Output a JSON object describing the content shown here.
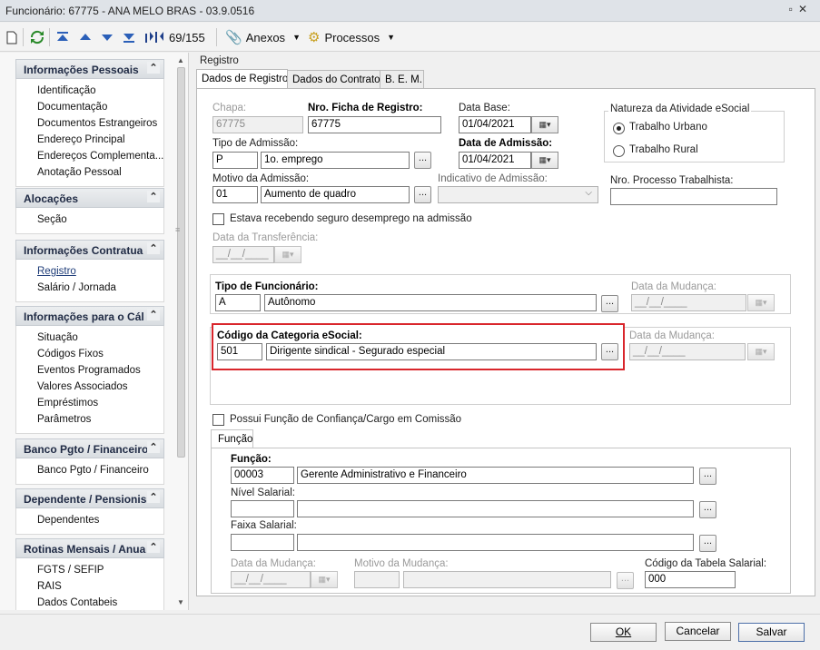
{
  "window": {
    "title": "Funcionário: 67775 - ANA MELO BRAS - 03.9.0516"
  },
  "toolbar": {
    "record_counter": "69/155",
    "anexos_label": "Anexos",
    "processos_label": "Processos"
  },
  "sidebar": {
    "groups": [
      {
        "title": "Informações Pessoais",
        "items": [
          "Identificação",
          "Documentação",
          "Documentos Estrangeiros",
          "Endereço Principal",
          "Endereços Complementa...",
          "Anotação Pessoal"
        ]
      },
      {
        "title": "Alocações",
        "items": [
          "Seção"
        ]
      },
      {
        "title": "Informações Contratua",
        "items": [
          "Registro",
          "Salário / Jornada"
        ],
        "selected": "Registro"
      },
      {
        "title": "Informações para o Cál",
        "items": [
          "Situação",
          "Códigos Fixos",
          "Eventos Programados",
          "Valores Associados",
          "Empréstimos",
          "Parâmetros"
        ]
      },
      {
        "title": "Banco Pgto / Financeiro",
        "items": [
          "Banco Pgto / Financeiro"
        ]
      },
      {
        "title": "Dependente / Pensionis",
        "items": [
          "Dependentes"
        ]
      },
      {
        "title": "Rotinas Mensais / Anua",
        "items": [
          "FGTS / SEFIP",
          "RAIS",
          "Dados Contabeis"
        ]
      }
    ]
  },
  "main": {
    "section_title": "Registro",
    "tabs": [
      "Dados de Registro",
      "Dados do Contrato",
      "B. E. M."
    ],
    "form": {
      "chapa_label": "Chapa:",
      "chapa_value": "67775",
      "nro_ficha_label": "Nro. Ficha de Registro:",
      "nro_ficha_value": "67775",
      "data_base_label": "Data Base:",
      "data_base_value": "01/04/2021",
      "tipo_admissao_label": "Tipo de Admissão:",
      "tipo_admissao_code": "P",
      "tipo_admissao_desc": "1o. emprego",
      "data_admissao_label": "Data de Admissão:",
      "data_admissao_value": "01/04/2021",
      "motivo_label": "Motivo da Admissão:",
      "motivo_code": "01",
      "motivo_desc": "Aumento de quadro",
      "indicativo_label": "Indicativo de Admissão:",
      "indicativo_value": "",
      "natureza_title": "Natureza da Atividade eSocial",
      "radio_urbano": "Trabalho Urbano",
      "radio_rural": "Trabalho Rural",
      "nro_processo_label": "Nro. Processo Trabalhista:",
      "nro_processo_value": "",
      "seguro_label": "Estava recebendo seguro desemprego na admissão",
      "data_transf_label": "Data da Transferência:",
      "date_placeholder": "__/__/____",
      "tipo_func_label": "Tipo de Funcionário:",
      "tipo_func_code": "A",
      "tipo_func_desc": "Autônomo",
      "data_mudanca_label": "Data da Mudança:",
      "categoria_label": "Código da Categoria eSocial:",
      "categoria_code": "501",
      "categoria_desc": "Dirigente sindical - Segurado especial",
      "confianca_label": "Possui Função de Confiança/Cargo em Comissão",
      "funcao_tab": "Função",
      "funcao_label": "Função:",
      "funcao_code": "00003",
      "funcao_desc": "Gerente Administrativo e Financeiro",
      "nivel_label": "Nível Salarial:",
      "faixa_label": "Faixa Salarial:",
      "motivo_mudanca_label": "Motivo da Mudança:",
      "codigo_tabela_label": "Código da Tabela Salarial:",
      "codigo_tabela_value": "000",
      "ellipsis": "..."
    }
  },
  "footer": {
    "ok": "OK",
    "cancel": "Cancelar",
    "save": "Salvar"
  },
  "colors": {
    "highlight": "#d9262c",
    "title_bg": "#dfe3e8"
  }
}
